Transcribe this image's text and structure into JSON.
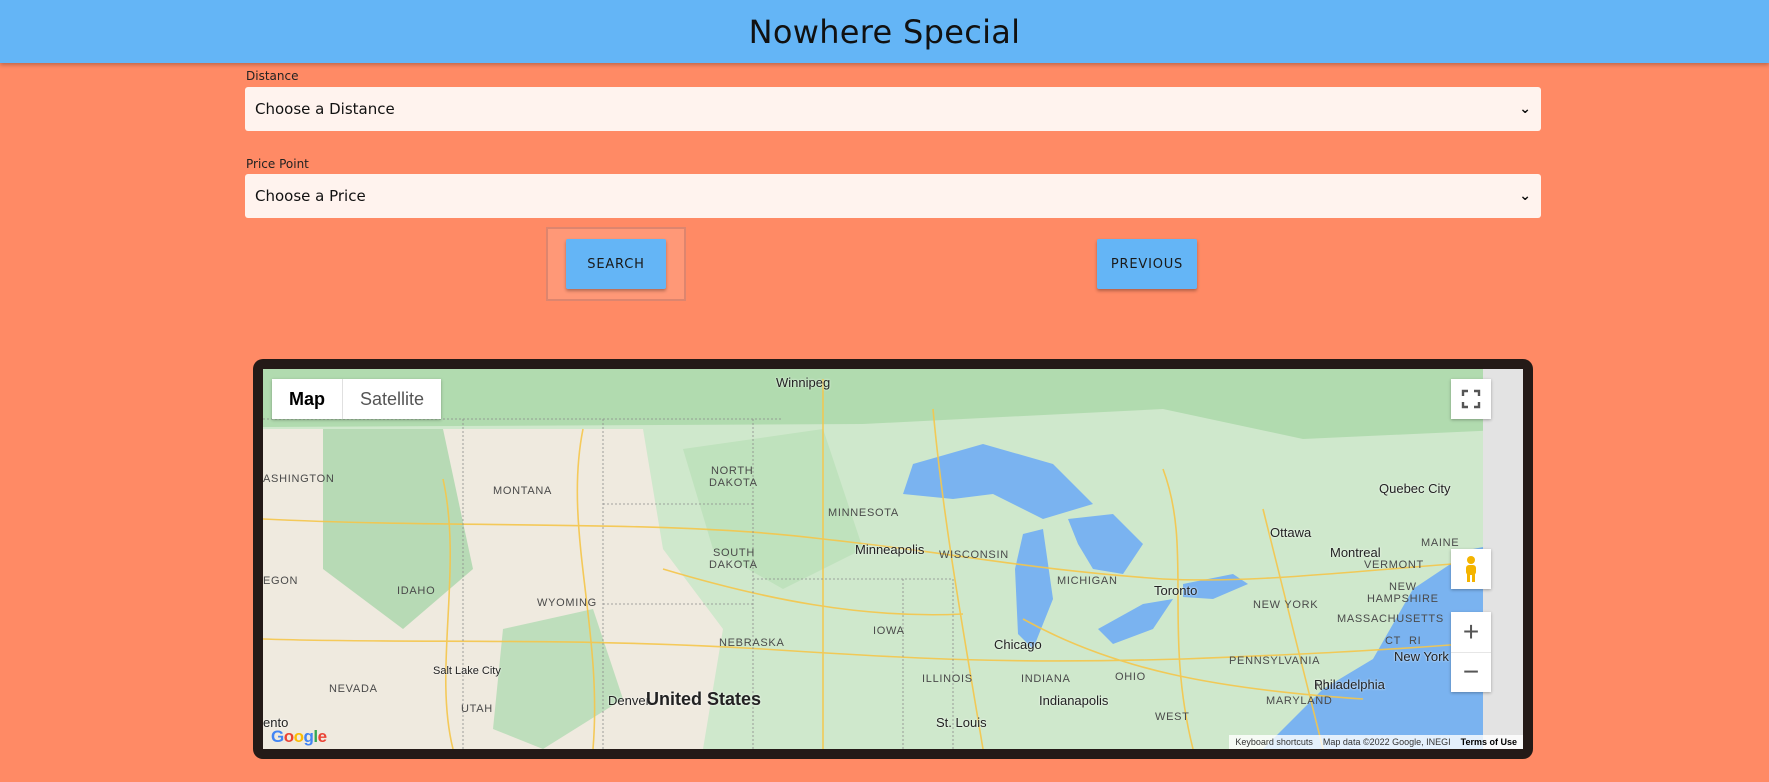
{
  "app": {
    "title": "Nowhere Special"
  },
  "distance": {
    "label": "Distance",
    "placeholder": "Choose a Distance"
  },
  "price": {
    "label": "Price Point",
    "placeholder": "Choose a Price"
  },
  "buttons": {
    "search": "SEARCH",
    "previous": "PREVIOUS"
  },
  "map": {
    "type_toggle": {
      "map": "Map",
      "satellite": "Satellite"
    },
    "country_label": "United States",
    "region_labels": [
      "ASHINGTON",
      "MONTANA",
      "NORTH",
      "DAKOTA",
      "SOUTH",
      "DAKOTA",
      "MINNESOTA",
      "WISCONSIN",
      "MICHIGAN",
      "IOWA",
      "NEBRASKA",
      "WYOMING",
      "IDAHO",
      "EGON",
      "NEVADA",
      "UTAH",
      "ILLINOIS",
      "INDIANA",
      "OHIO",
      "PENNSYLVANIA",
      "NEW YORK",
      "VERMONT",
      "NEW",
      "HAMPSHIRE",
      "MASSACHUSETTS",
      "MAINE",
      "CT",
      "RI",
      "MARYLAND",
      "NJ",
      "WEST"
    ],
    "cities": [
      "Winnipeg",
      "Minneapolis",
      "Chicago",
      "Toronto",
      "Ottawa",
      "Montreal",
      "Quebec City",
      "New York",
      "Philadelphia",
      "Indianapolis",
      "St. Louis",
      "Denver",
      "Salt Lake City",
      "ento"
    ],
    "attribution": {
      "shortcuts": "Keyboard shortcuts",
      "data": "Map data ©2022 Google, INEGI",
      "terms": "Terms of Use"
    },
    "logo": "Google",
    "controls": {
      "fullscreen": "fullscreen-icon",
      "pegman": "pegman-icon",
      "zoom_in": "+",
      "zoom_out": "−"
    }
  },
  "colors": {
    "header": "#64b5f6",
    "background": "#ff8a65",
    "button": "#64b5f6",
    "select_bg": "#fff3ee"
  }
}
